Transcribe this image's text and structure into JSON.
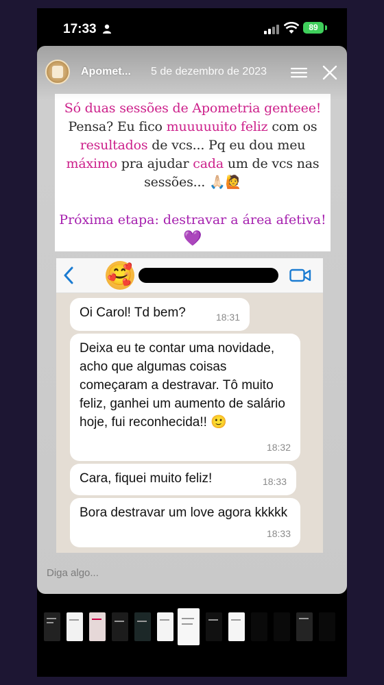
{
  "status_bar": {
    "time": "17:33",
    "battery": "89"
  },
  "story": {
    "username": "Apomet...",
    "date": "5 de dezembro de 2023",
    "caption": {
      "p1": "Só duas sessões de Apometria genteee!",
      "p2": "Pensa? Eu fico",
      "p3": "muuuuuito feliz",
      "p4": "com os",
      "p5": "resultados",
      "p6": "de vcs... Pq eu dou meu",
      "p7": "máximo",
      "p8": "pra ajudar",
      "p9": "cada",
      "p10": "um de vcs nas",
      "p11": "sessões... 🙏🏻🙋"
    },
    "next_step": "Próxima etapa: destravar a área afetiva!",
    "next_step_emoji": "💜",
    "reply_placeholder": "Diga algo..."
  },
  "chat": {
    "avatar_emoji": "🥰",
    "messages": [
      {
        "text": "Oi Carol! Td bem?",
        "time": "18:31"
      },
      {
        "text": "Deixa eu te contar uma novidade, acho que algumas coisas começaram a destravar. Tô muito feliz, ganhei um aumento de salário hoje, fui reconhecida!! 🙂",
        "time": "18:32"
      },
      {
        "text": "Cara, fiquei muito feliz!",
        "time": "18:33"
      },
      {
        "text": "Bora destravar um love agora kkkkk",
        "time": "18:33"
      }
    ]
  },
  "colors": {
    "accent_pink": "#cc1f8a",
    "accent_purple": "#a51fae",
    "battery_green": "#3fcf5b",
    "wa_blue": "#1a7bd1"
  },
  "icons": [
    "person-icon",
    "signal-icon",
    "wifi-icon",
    "battery-icon",
    "menu-icon",
    "close-icon",
    "back-chevron-icon",
    "video-call-icon"
  ]
}
